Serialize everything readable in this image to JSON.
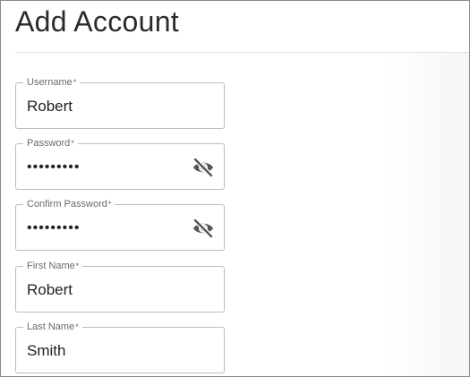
{
  "page": {
    "title": "Add Account"
  },
  "form": {
    "required_marker": "*",
    "fields": [
      {
        "label": "Username",
        "value": "Robert",
        "type": "text"
      },
      {
        "label": "Password",
        "value": "•••••••••",
        "type": "password",
        "toggle_icon": "eye-off-icon"
      },
      {
        "label": "Confirm Password",
        "value": "•••••••••",
        "type": "password",
        "toggle_icon": "eye-off-icon"
      },
      {
        "label": "First Name",
        "value": "Robert",
        "type": "text"
      },
      {
        "label": "Last Name",
        "value": "Smith",
        "type": "text"
      }
    ]
  }
}
